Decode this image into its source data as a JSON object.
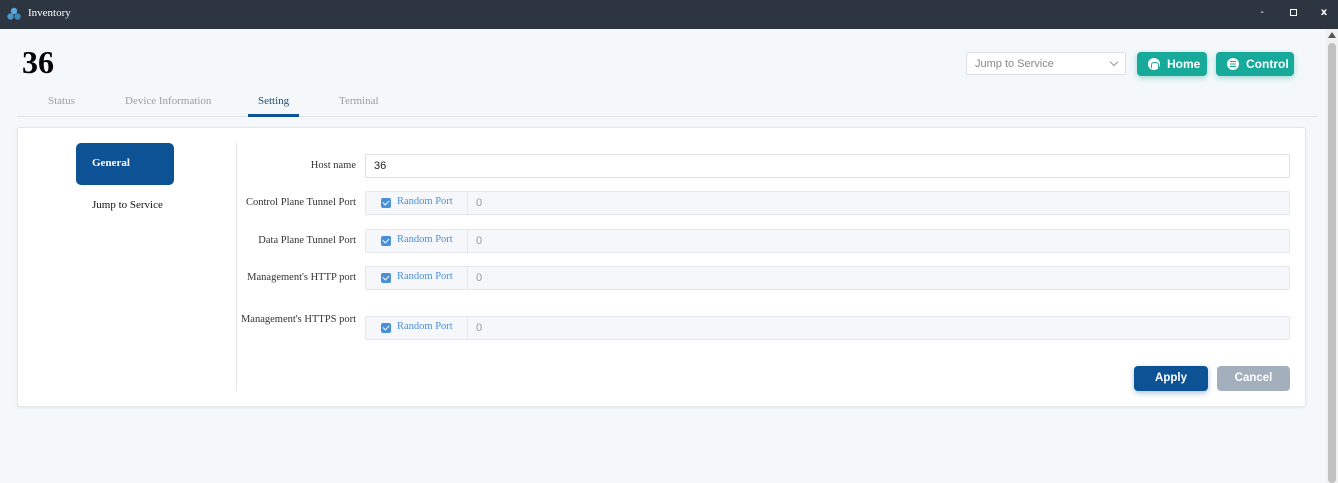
{
  "window": {
    "title": "Inventory",
    "minimize": "-",
    "close": "x"
  },
  "page": {
    "title": "36"
  },
  "header": {
    "jump_select": "Jump to Service",
    "home_label": "Home",
    "control_label": "Control",
    "accent": "#17a999"
  },
  "tabs": [
    {
      "label": "Status"
    },
    {
      "label": "Device Information"
    },
    {
      "label": "Setting"
    },
    {
      "label": "Terminal"
    }
  ],
  "sidebar": {
    "items": [
      {
        "label": "General"
      },
      {
        "label": "Jump to Service"
      }
    ],
    "active_color": "#0d5295"
  },
  "form": {
    "host_name_label": "Host name",
    "host_name_value": "36",
    "ports": [
      {
        "label": "Control Plane Tunnel Port",
        "checkbox_label": "Random Port",
        "value": "0"
      },
      {
        "label": "Data Plane Tunnel Port",
        "checkbox_label": "Random Port",
        "value": "0"
      },
      {
        "label": "Management's HTTP port",
        "checkbox_label": "Random Port",
        "value": "0"
      },
      {
        "label": "Management's HTTPS port",
        "checkbox_label": "Random Port",
        "value": "0"
      }
    ],
    "apply_label": "Apply",
    "cancel_label": "Cancel"
  }
}
